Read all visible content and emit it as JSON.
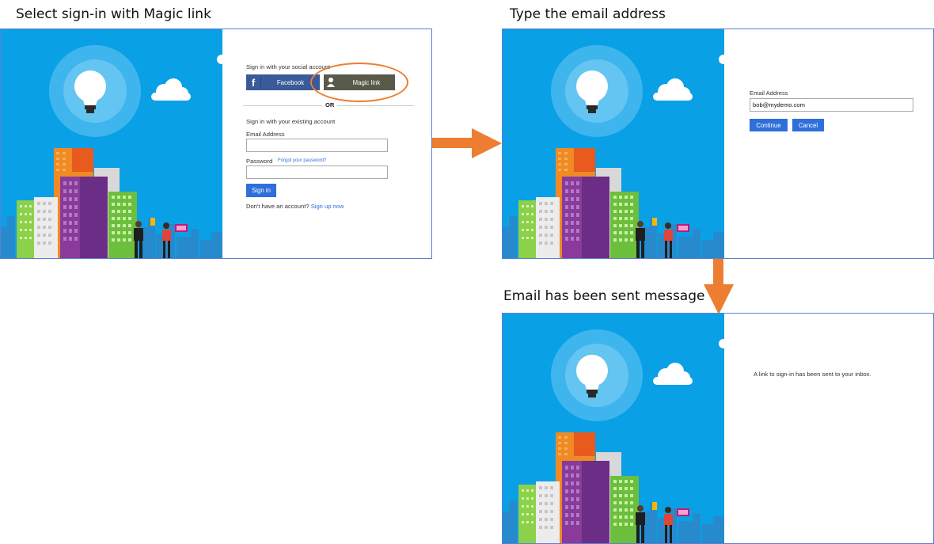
{
  "captions": {
    "step1": "Select sign-in with Magic link",
    "step2": "Type the email address",
    "step3": "Email has been sent message"
  },
  "panel1": {
    "social_heading": "Sign in with your social account",
    "facebook_label": "Facebook",
    "magic_link_label": "Magic link",
    "or_label": "OR",
    "existing_heading": "Sign in with your existing account",
    "email_label": "Email Address",
    "email_value": "",
    "password_label": "Password",
    "forgot_password": "Forgot your password?",
    "password_value": "",
    "sign_in_label": "Sign in",
    "no_account_text": "Don't have an account?",
    "sign_up_link": "Sign up now"
  },
  "panel2": {
    "email_label": "Email Address",
    "email_value": "bob@mydemo.com",
    "continue_label": "Continue",
    "cancel_label": "Cancel"
  },
  "panel3": {
    "message": "A link to sign-in has been sent to your inbox."
  },
  "colors": {
    "sky_blue": "#0aa0e6",
    "button_blue": "#2f6fd9",
    "facebook_blue": "#3b5a9a",
    "magic_link_dark": "#5a5a4a",
    "highlight_orange": "#ed7d31",
    "panel_border": "#5b7fd6"
  },
  "icons": [
    "lightbulb-icon",
    "cloud-icon",
    "facebook-icon",
    "person-icon",
    "arrow-right-icon",
    "arrow-down-icon"
  ]
}
